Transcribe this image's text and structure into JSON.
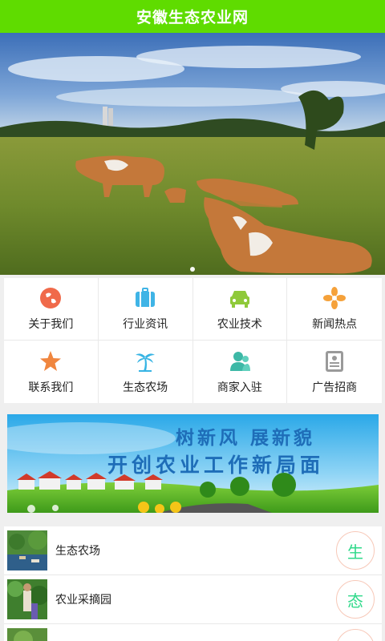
{
  "header": {
    "title": "安徽生态农业网"
  },
  "banner": {
    "slide_count": 1,
    "active_slide": 0
  },
  "menu": [
    {
      "label": "关于我们",
      "icon": "globe-icon",
      "color": "#f06a4a"
    },
    {
      "label": "行业资讯",
      "icon": "luggage-icon",
      "color": "#3fb4e6"
    },
    {
      "label": "农业技术",
      "icon": "car-icon",
      "color": "#8fc93a"
    },
    {
      "label": "新闻热点",
      "icon": "flower-icon",
      "color": "#f5a13a"
    },
    {
      "label": "联系我们",
      "icon": "star-icon",
      "color": "#f0863f"
    },
    {
      "label": "生态农场",
      "icon": "palm-tree-icon",
      "color": "#37b4e4"
    },
    {
      "label": "商家入驻",
      "icon": "users-icon",
      "color": "#3db8a6"
    },
    {
      "label": "广告招商",
      "icon": "document-icon",
      "color": "#9a9a9a"
    }
  ],
  "promo": {
    "line1": "树新风  展新貌",
    "line2": "开创农业工作新局面"
  },
  "list": [
    {
      "title": "生态农场",
      "badge": "生"
    },
    {
      "title": "农业采摘园",
      "badge": "态"
    },
    {
      "title": "",
      "badge": ""
    }
  ]
}
